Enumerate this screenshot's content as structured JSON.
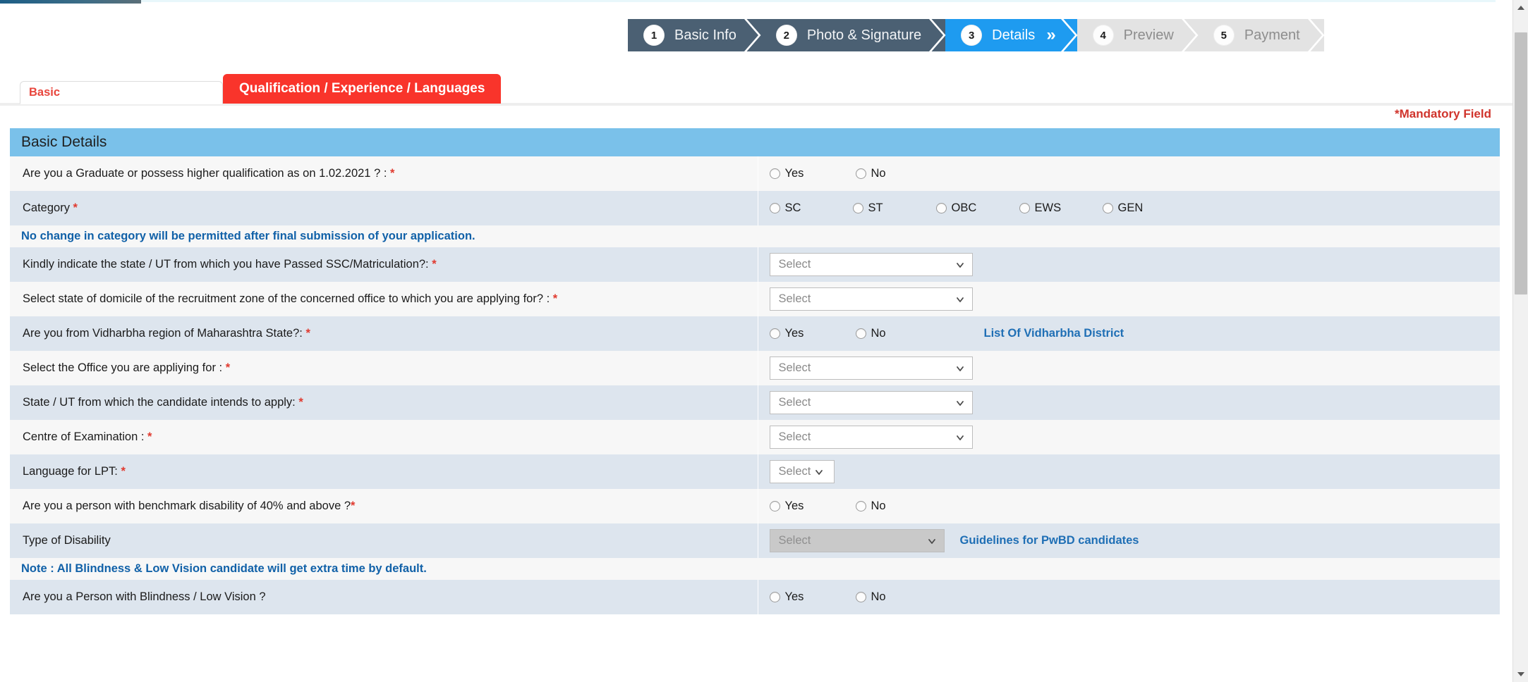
{
  "wizard": {
    "steps": [
      {
        "num": "1",
        "label": "Basic Info",
        "state": "done"
      },
      {
        "num": "2",
        "label": "Photo & Signature",
        "state": "done"
      },
      {
        "num": "3",
        "label": "Details",
        "state": "active"
      },
      {
        "num": "4",
        "label": "Preview",
        "state": "pending"
      },
      {
        "num": "5",
        "label": "Payment",
        "state": "pending"
      }
    ],
    "active_chevron": "»",
    "colors": {
      "done": "#4b6073",
      "active": "#1e9bf0",
      "pending": "#e3e3e3"
    }
  },
  "tabs": [
    {
      "label": "Basic",
      "selected": true
    },
    {
      "label": "Qualification / Experience / Languages",
      "selected": false
    }
  ],
  "mandatory_note": "*Mandatory Field",
  "section": {
    "title": "Basic Details"
  },
  "common": {
    "yes": "Yes",
    "no": "No",
    "select_placeholder": "Select",
    "required_mark": "*"
  },
  "rows": [
    {
      "label": "Are you a Graduate or possess higher qualification as on 1.02.2021 ? : ",
      "required": true,
      "type": "radio",
      "options": [
        "Yes",
        "No"
      ]
    },
    {
      "label": "Category ",
      "required": true,
      "type": "radio",
      "options": [
        "SC",
        "ST",
        "OBC",
        "EWS",
        "GEN"
      ]
    },
    {
      "type": "note",
      "text": "No change in category will be permitted after final submission of your application."
    },
    {
      "label": "Kindly indicate the state / UT from which you have Passed SSC/Matriculation?: ",
      "required": true,
      "type": "select",
      "value": "Select"
    },
    {
      "label": "Select state of domicile of the recruitment zone of the concerned office to which you are applying for? : ",
      "required": true,
      "type": "select",
      "value": "Select"
    },
    {
      "label": "Are you from Vidharbha region of Maharashtra State?: ",
      "required": true,
      "type": "radio",
      "options": [
        "Yes",
        "No"
      ],
      "link": "List Of Vidharbha District"
    },
    {
      "label": "Select the Office you are appliying for : ",
      "required": true,
      "type": "select",
      "value": "Select"
    },
    {
      "label": "State / UT from which the candidate intends to apply: ",
      "required": true,
      "type": "select",
      "value": "Select"
    },
    {
      "label": "Centre of Examination : ",
      "required": true,
      "type": "select",
      "value": "Select"
    },
    {
      "label": "Language for LPT: ",
      "required": true,
      "type": "select-small",
      "value": "Select"
    },
    {
      "label": "Are you a person with benchmark disability of 40% and above ?",
      "required": true,
      "type": "radio",
      "options": [
        "Yes",
        "No"
      ]
    },
    {
      "label": "Type of Disability",
      "required": false,
      "type": "select-disabled",
      "value": "Select",
      "link": "Guidelines for PwBD candidates"
    },
    {
      "type": "note",
      "text": "Note : All Blindness & Low Vision candidate will get extra time by default."
    },
    {
      "label": "Are you a Person with Blindness / Low Vision ?",
      "required": false,
      "type": "radio",
      "options": [
        "Yes",
        "No"
      ]
    }
  ],
  "scrollbar": {
    "up_arrow": "scroll-up",
    "down_arrow": "scroll-down"
  }
}
